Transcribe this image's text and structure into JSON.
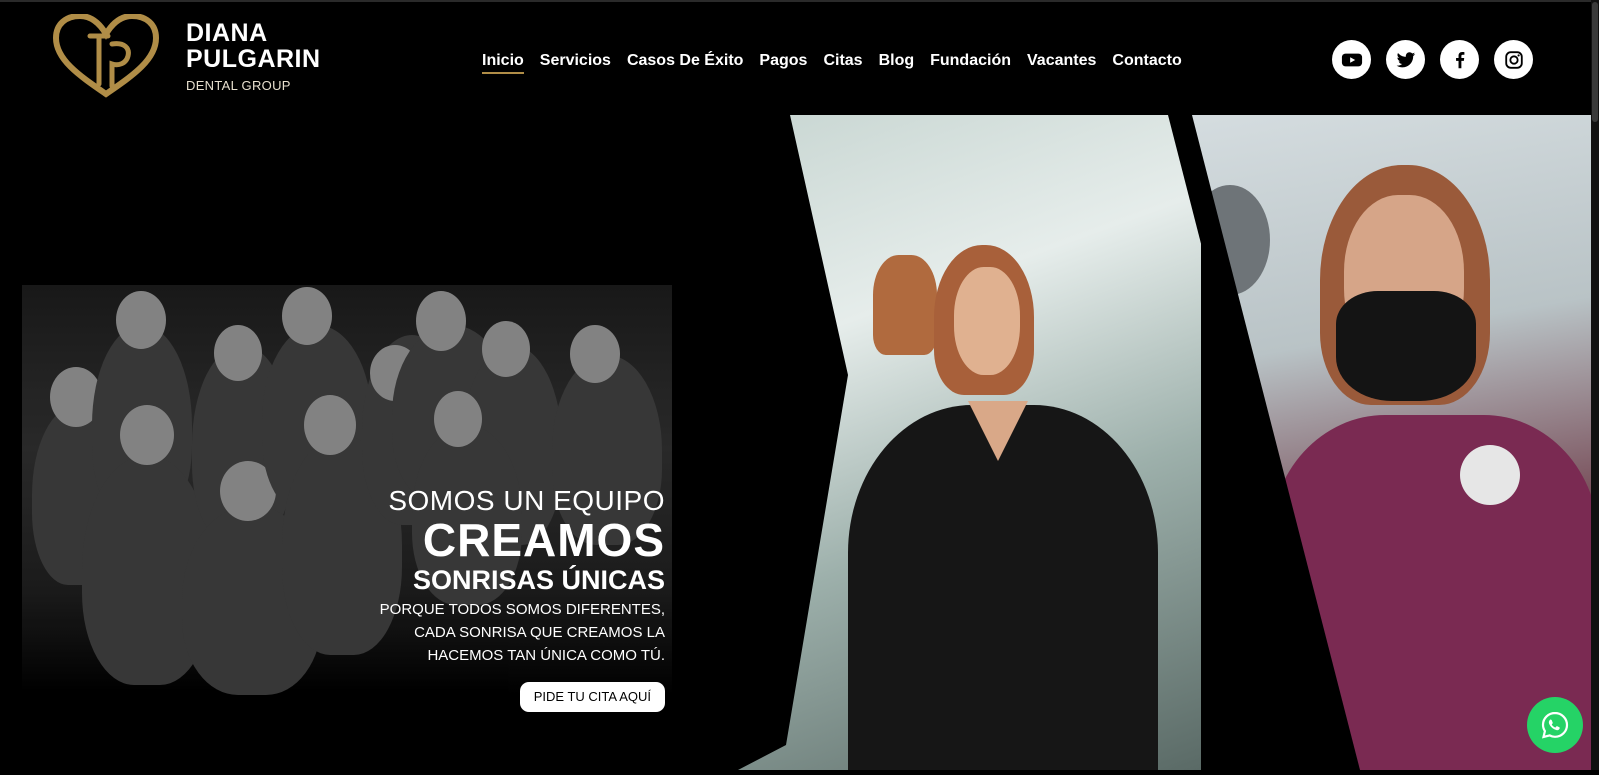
{
  "brand": {
    "name_line1": "DIANA",
    "name_line2": "PULGARIN",
    "subtitle": "DENTAL GROUP",
    "logo_icon": "heart-dp-monogram-icon",
    "gold": "#b08d47"
  },
  "nav": {
    "items": [
      {
        "label": "Inicio",
        "active": true
      },
      {
        "label": "Servicios"
      },
      {
        "label": "Casos De Éxito"
      },
      {
        "label": "Pagos"
      },
      {
        "label": "Citas"
      },
      {
        "label": "Blog"
      },
      {
        "label": "Fundación"
      },
      {
        "label": "Vacantes"
      },
      {
        "label": "Contacto"
      }
    ]
  },
  "social": {
    "icons": [
      "youtube-icon",
      "twitter-icon",
      "facebook-icon",
      "instagram-icon"
    ]
  },
  "hero": {
    "line1": "SOMOS UN EQUIPO",
    "line2": "CREAMOS",
    "line3": "SONRISAS ÚNICAS",
    "desc1": "PORQUE TODOS SOMOS DIFERENTES,",
    "desc2": "CADA SONRISA QUE CREAMOS LA",
    "desc3": "HACEMOS TAN ÚNICA COMO TÚ.",
    "cta_label": "PIDE TU CITA AQUÍ"
  },
  "whatsapp": {
    "icon": "whatsapp-icon",
    "color": "#25d366"
  }
}
